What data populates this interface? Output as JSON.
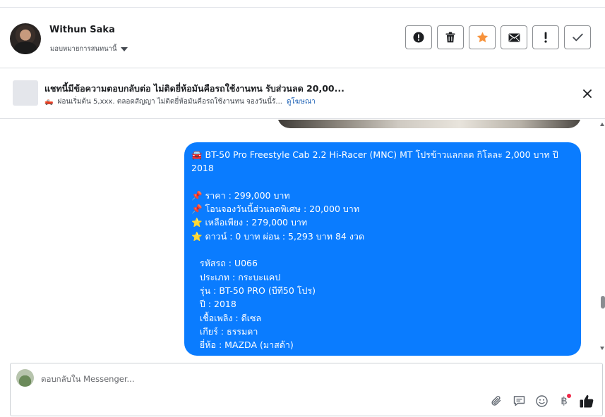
{
  "header": {
    "user_name": "Withun Saka",
    "assign_label": "มอบหมายการสนทนานี้",
    "actions": [
      {
        "name": "spam-button",
        "icon": "exclamation-circle-icon"
      },
      {
        "name": "delete-button",
        "icon": "trash-icon"
      },
      {
        "name": "star-button",
        "icon": "star-icon",
        "color": "#f7923b"
      },
      {
        "name": "mark-unread-button",
        "icon": "envelope-icon"
      },
      {
        "name": "follow-up-button",
        "icon": "exclamation-icon"
      },
      {
        "name": "done-button",
        "icon": "check-icon"
      }
    ]
  },
  "ad": {
    "title": "แชทนี้มีข้อความตอบกลับต่อ ไม่ติดยี่ห้อมันคือรถใช้งานทน รับส่วนลด 20,00...",
    "subtitle_icon": "🛻",
    "subtitle": "ผ่อนเริ่มต้น 5,xxx. ตลอดสัญญา ไม่ติดยี่ห้อมันคือรถใช้งานทน จองวันนี้รั...",
    "link": "ดูโฆษณา"
  },
  "message": {
    "lines": [
      "🚘 BT-50 Pro Freestyle Cab 2.2 Hi-Racer (MNC) MT โปรข้าวแลกลด กิโลละ 2,000 บาท ปี",
      "2018",
      "",
      "📌 ราคา : 299,000 บาท",
      "📌 โอนจองวันนี้ส่วนลดพิเศษ : 20,000 บาท",
      "⭐ เหลือเพียง : 279,000 บาท",
      "⭐ ดาวน์ : 0 บาท ผ่อน : 5,293 บาท 84 งวด",
      "",
      "   รหัสรถ : U066",
      "   ประเภท : กระบะแคป",
      "   รุ่น : BT-50 PRO (บีที50 โปร)",
      "   ปี : 2018",
      "   เชื้อเพลิง : ดีเซล",
      "   เกียร์ : ธรรมดา",
      "   ยี่ห้อ : MAZDA (มาสด้า)"
    ],
    "bubble_color": "#0a7cff"
  },
  "composer": {
    "placeholder": "ตอบกลับใน Messenger...",
    "value": "",
    "tools": [
      "paperclip-icon",
      "saved-reply-icon",
      "emoji-icon",
      "baht-payment-icon",
      "thumbs-up-icon"
    ]
  }
}
